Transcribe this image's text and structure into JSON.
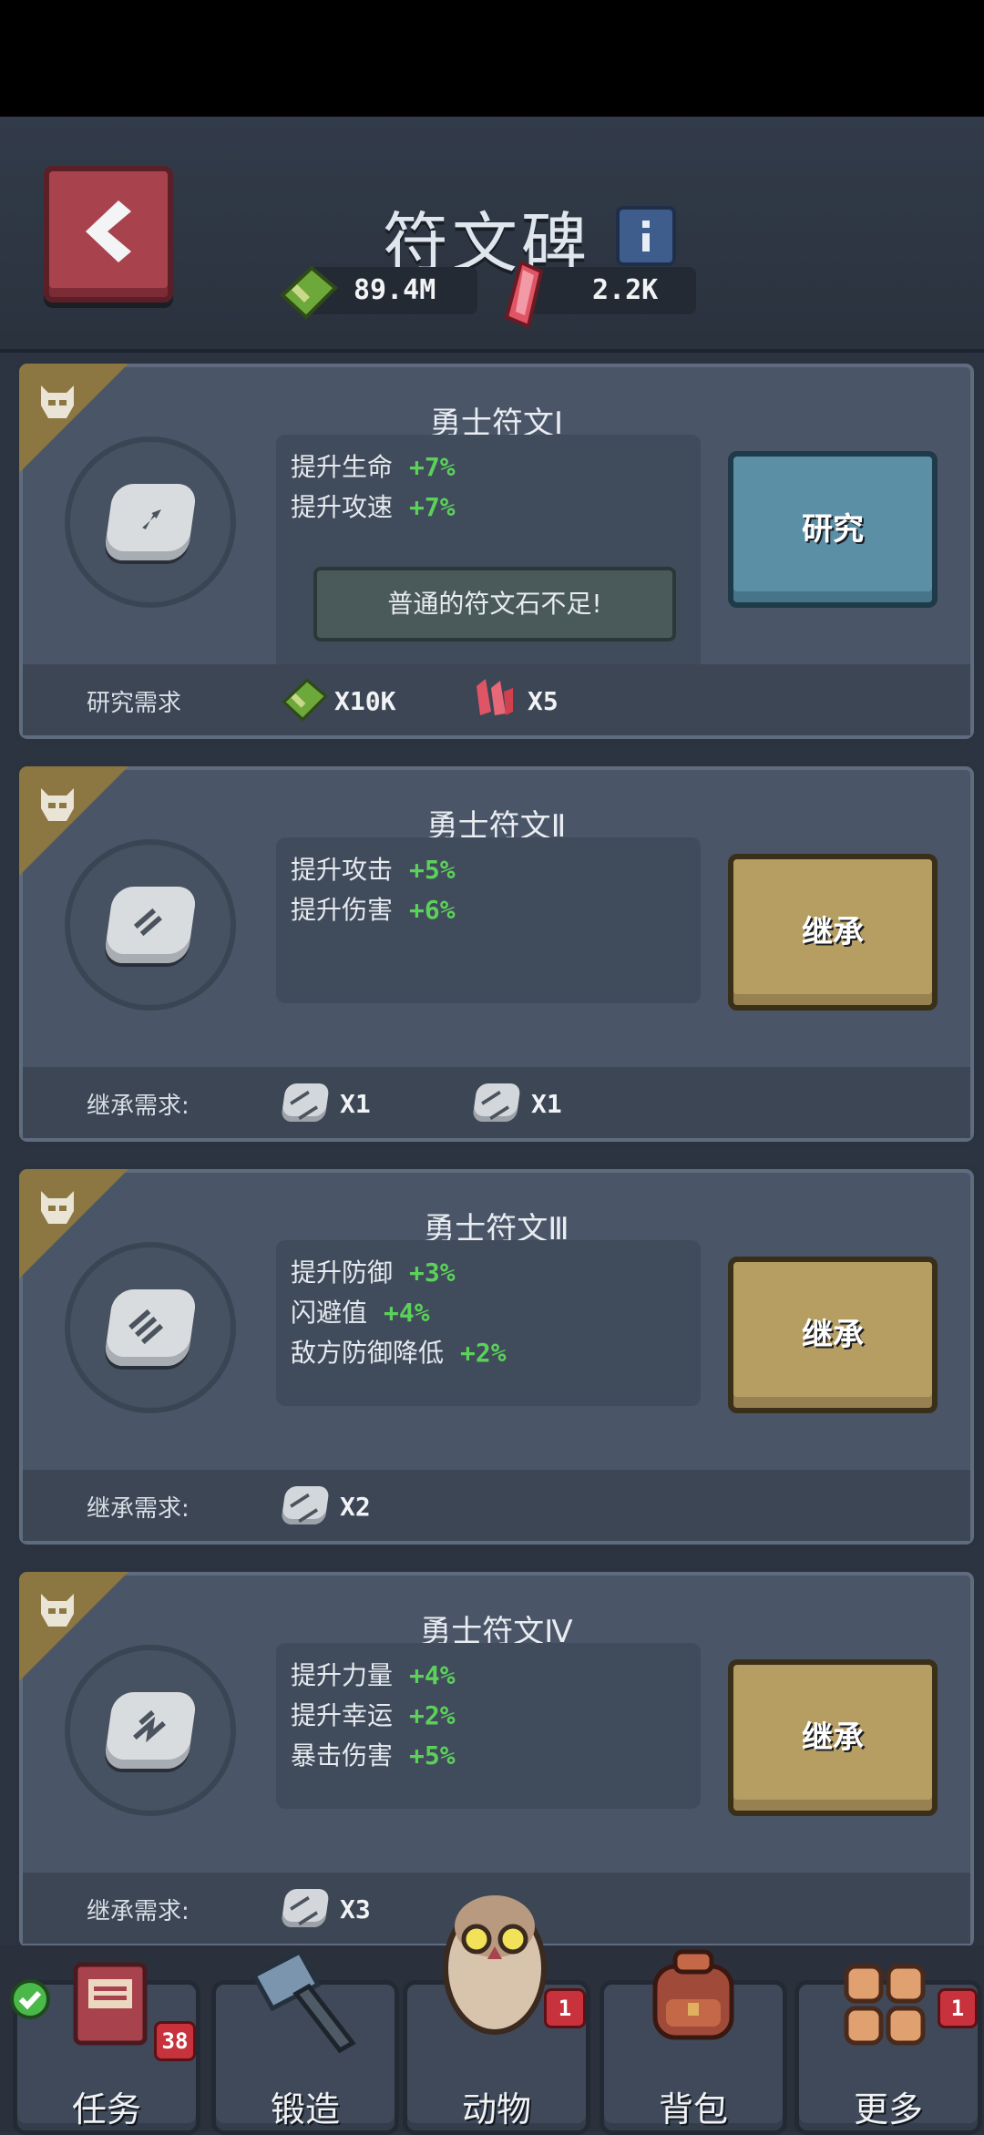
{
  "header": {
    "title": "符文碑",
    "currency_cash": "89.4M",
    "currency_gem": "2.2K"
  },
  "colors": {
    "stat_positive": "#5bd15a",
    "research_button": "#5b8fa5",
    "inherit_button": "#b69e63",
    "badge": "#8c7641"
  },
  "runes": [
    {
      "title": "勇士符文Ⅰ",
      "stats": [
        {
          "label": "提升生命",
          "value": "+7%"
        },
        {
          "label": "提升攻速",
          "value": "+7%"
        }
      ],
      "action": "研究",
      "warning": "普通的符文石不足!",
      "req_label": "研究需求",
      "reqs": [
        {
          "icon": "cash-icon",
          "qty": "X10K"
        },
        {
          "icon": "red-crystal-icon",
          "qty": "X5"
        }
      ]
    },
    {
      "title": "勇士符文Ⅱ",
      "stats": [
        {
          "label": "提升攻击",
          "value": "+5%"
        },
        {
          "label": "提升伤害",
          "value": "+6%"
        }
      ],
      "action": "继承",
      "req_label": "继承需求:",
      "reqs": [
        {
          "icon": "rune-stone-icon",
          "qty": "X1"
        },
        {
          "icon": "rune-stone-icon",
          "qty": "X1"
        }
      ]
    },
    {
      "title": "勇士符文Ⅲ",
      "stats": [
        {
          "label": "提升防御",
          "value": "+3%"
        },
        {
          "label": "闪避值",
          "value": "+4%"
        },
        {
          "label": "敌方防御降低",
          "value": "+2%"
        }
      ],
      "action": "继承",
      "req_label": "继承需求:",
      "reqs": [
        {
          "icon": "rune-stone-icon",
          "qty": "X2"
        }
      ]
    },
    {
      "title": "勇士符文Ⅳ",
      "stats": [
        {
          "label": "提升力量",
          "value": "+4%"
        },
        {
          "label": "提升幸运",
          "value": "+2%"
        },
        {
          "label": "暴击伤害",
          "value": "+5%"
        }
      ],
      "action": "继承",
      "req_label": "继承需求:",
      "reqs": [
        {
          "icon": "rune-stone-icon",
          "qty": "X3"
        }
      ]
    }
  ],
  "nav": [
    {
      "label": "任务",
      "icon": "quest-book-icon",
      "badge": "38"
    },
    {
      "label": "锻造",
      "icon": "hammer-icon"
    },
    {
      "label": "动物",
      "icon": "owl-pet-icon",
      "badge": "1"
    },
    {
      "label": "背包",
      "icon": "backpack-icon"
    },
    {
      "label": "更多",
      "icon": "grid-more-icon",
      "badge": "1"
    }
  ]
}
